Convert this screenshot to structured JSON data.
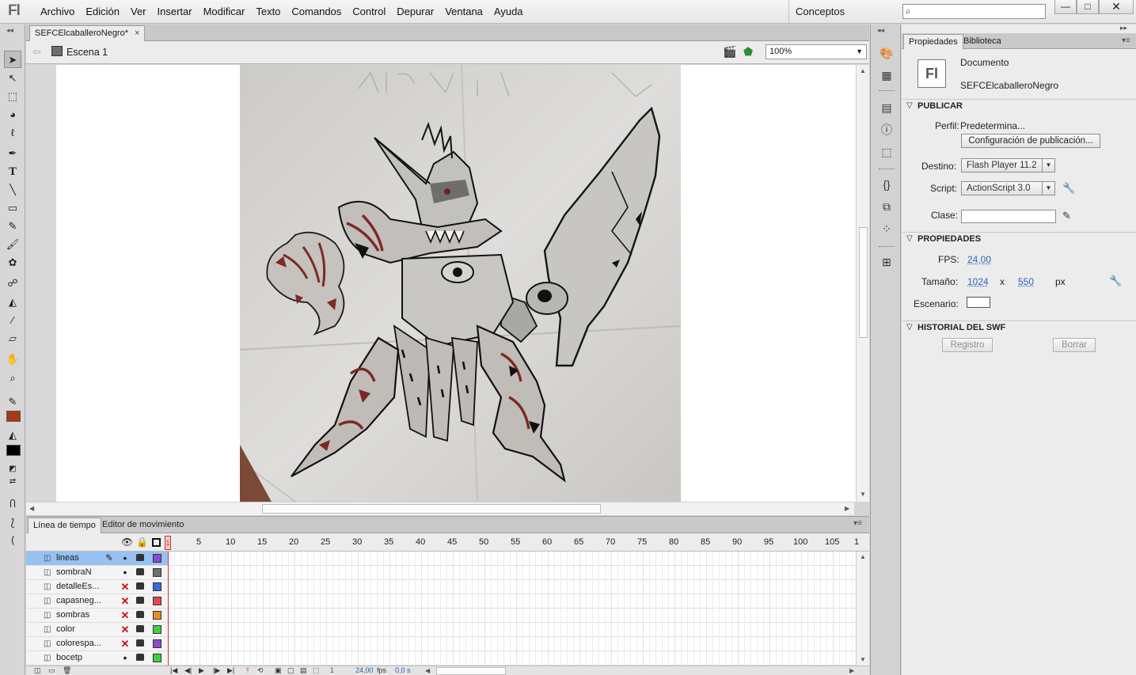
{
  "app": {
    "logo": "Fl",
    "menu": [
      "Archivo",
      "Edición",
      "Ver",
      "Insertar",
      "Modificar",
      "Texto",
      "Comandos",
      "Control",
      "Depurar",
      "Ventana",
      "Ayuda"
    ],
    "workspace": "Conceptos básicos",
    "window_buttons": {
      "minimize": "—",
      "maximize": "□",
      "close": "✕"
    }
  },
  "document": {
    "tab_title": "SEFCElcaballeroNegro*",
    "tab_close": "×",
    "scene": "Escena 1",
    "zoom": "100%"
  },
  "colors": {
    "stroke": "#a73a12",
    "fill": "#000000",
    "selected_layer": "#96c1f0"
  },
  "timeline": {
    "tabs": [
      "Línea de tiempo",
      "Editor de movimiento"
    ],
    "frame_numbers": [
      "1",
      "5",
      "10",
      "15",
      "20",
      "25",
      "30",
      "35",
      "40",
      "45",
      "50",
      "55",
      "60",
      "65",
      "70",
      "75",
      "80",
      "85",
      "90",
      "95",
      "100",
      "105",
      "1"
    ],
    "layers": [
      {
        "name": "lineas",
        "visible": true,
        "color": "#8a4bd6",
        "selected": true
      },
      {
        "name": "sombraN",
        "visible": true,
        "color": "#6e6e6e"
      },
      {
        "name": "detalleEs...",
        "visible": false,
        "color": "#3f67e0"
      },
      {
        "name": "capasneg...",
        "visible": false,
        "color": "#e04a4a"
      },
      {
        "name": "sombras",
        "visible": false,
        "color": "#f08a20"
      },
      {
        "name": "color",
        "visible": false,
        "color": "#3fcf3f"
      },
      {
        "name": "colorespa...",
        "visible": false,
        "color": "#8a4bd6"
      },
      {
        "name": "bocetp",
        "visible": true,
        "color": "#3fcf3f"
      }
    ],
    "current_frame": "1",
    "fps": "24,00",
    "fps_unit": "fps",
    "elapsed": "0,0 s"
  },
  "properties": {
    "tabs": [
      "Propiedades",
      "Biblioteca"
    ],
    "badge": "Fl",
    "type": "Documento",
    "name": "SEFCElcaballeroNegro",
    "sections": {
      "publish": "PUBLICAR",
      "properties": "PROPIEDADES",
      "swf_history": "HISTORIAL DEL SWF"
    },
    "publish": {
      "profile_label": "Perfil:",
      "profile_value": "Predetermina...",
      "settings_button": "Configuración de publicación...",
      "target_label": "Destino:",
      "target_value": "Flash Player 11.2",
      "script_label": "Script:",
      "script_value": "ActionScript 3.0",
      "class_label": "Clase:",
      "class_value": ""
    },
    "props": {
      "fps_label": "FPS:",
      "fps_value": "24,00",
      "size_label": "Tamaño:",
      "width": "1024",
      "x": "x",
      "height": "550",
      "unit": "px",
      "stage_label": "Escenario:",
      "stage_color": "#ffffff"
    },
    "history": {
      "log_button": "Registro",
      "clear_button": "Borrar"
    }
  }
}
